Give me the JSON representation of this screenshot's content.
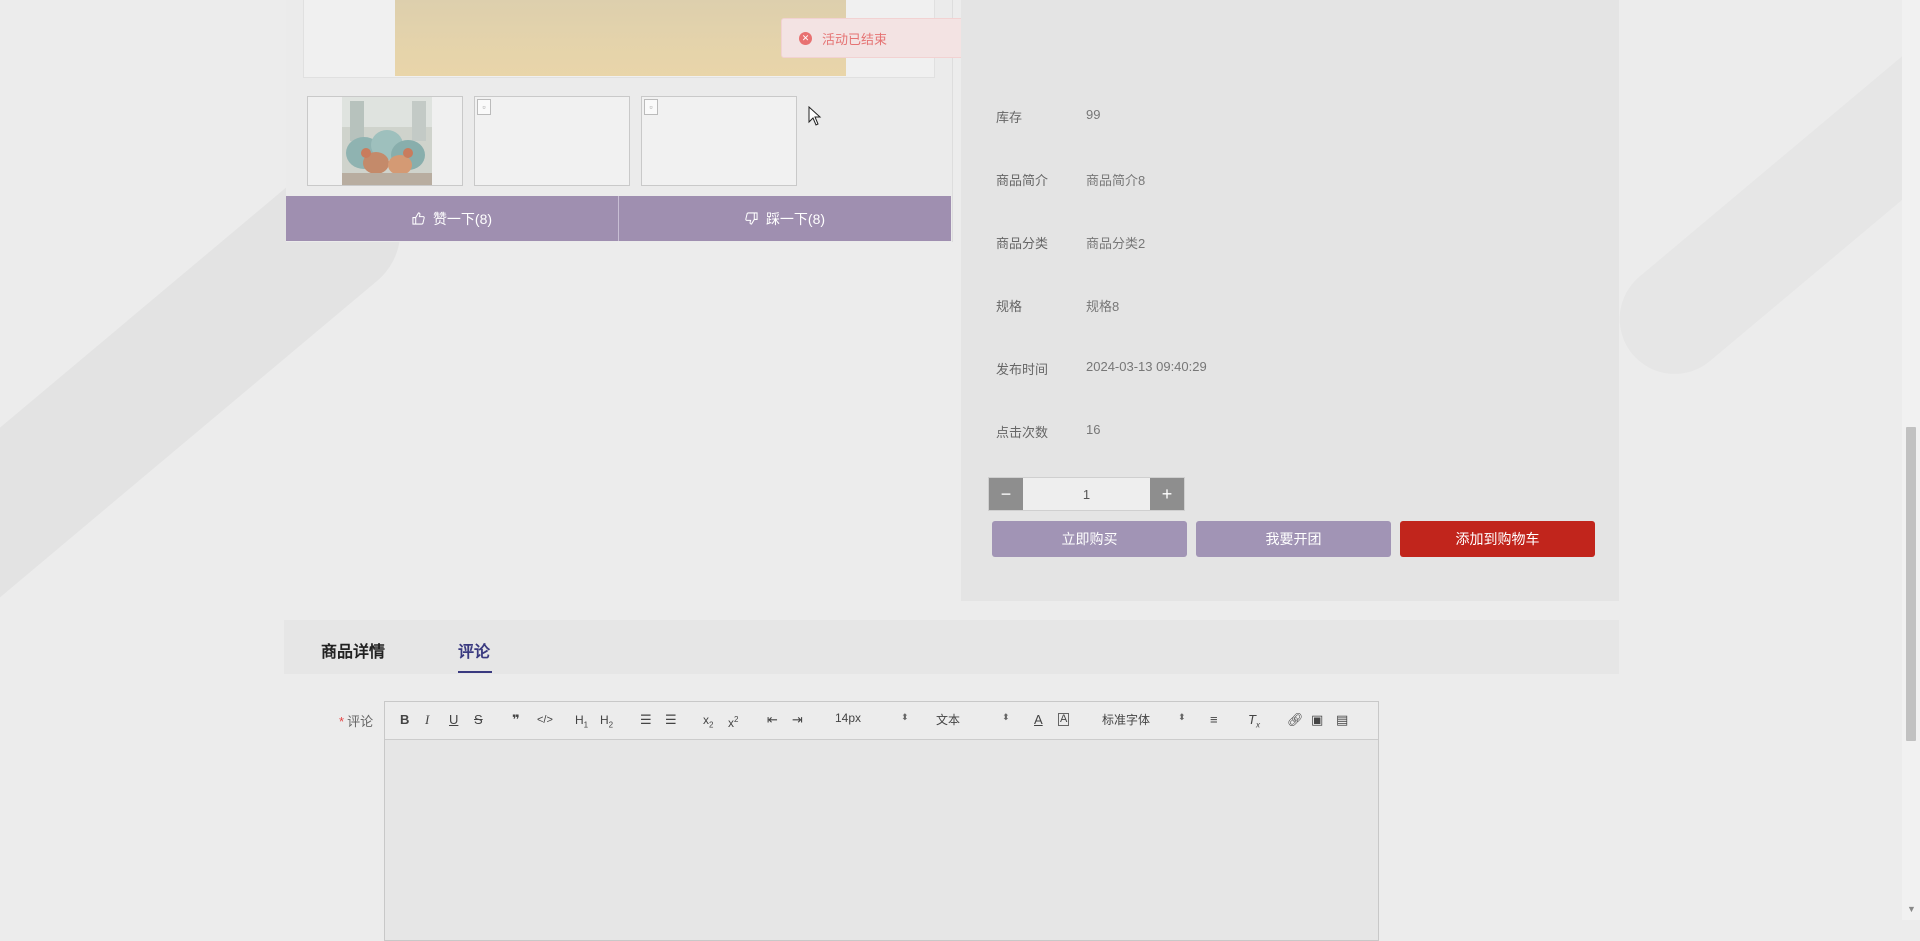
{
  "toast": {
    "message": "活动已结束"
  },
  "gallery": {
    "thumbnails": [
      "pillows",
      "broken",
      "broken"
    ]
  },
  "vote": {
    "like_label": "赞一下(8)",
    "dislike_label": "踩一下(8)"
  },
  "product_info": {
    "rows": [
      {
        "key": "库存",
        "value": "99"
      },
      {
        "key": "商品简介",
        "value": "商品简介8"
      },
      {
        "key": "商品分类",
        "value": "商品分类2"
      },
      {
        "key": "规格",
        "value": "规格8"
      },
      {
        "key": "发布时间",
        "value": "2024-03-13 09:40:29"
      },
      {
        "key": "点击次数",
        "value": "16"
      }
    ]
  },
  "quantity": {
    "value": "1",
    "minus": "−",
    "plus": "+"
  },
  "actions": {
    "buy_now": "立即购买",
    "group_buy": "我要开团",
    "add_to_cart": "添加到购物车"
  },
  "tabs": [
    {
      "label": "商品详情",
      "active": false
    },
    {
      "label": "评论",
      "active": true
    }
  ],
  "comment": {
    "required_mark": "*",
    "label": "评论",
    "toolbar": {
      "font_size": "14px",
      "header_type": "文本",
      "font_family": "标准字体"
    }
  },
  "colors": {
    "accent_purple": "#a194b5",
    "cart_red": "#c1251c",
    "toast_text": "#e57373"
  }
}
